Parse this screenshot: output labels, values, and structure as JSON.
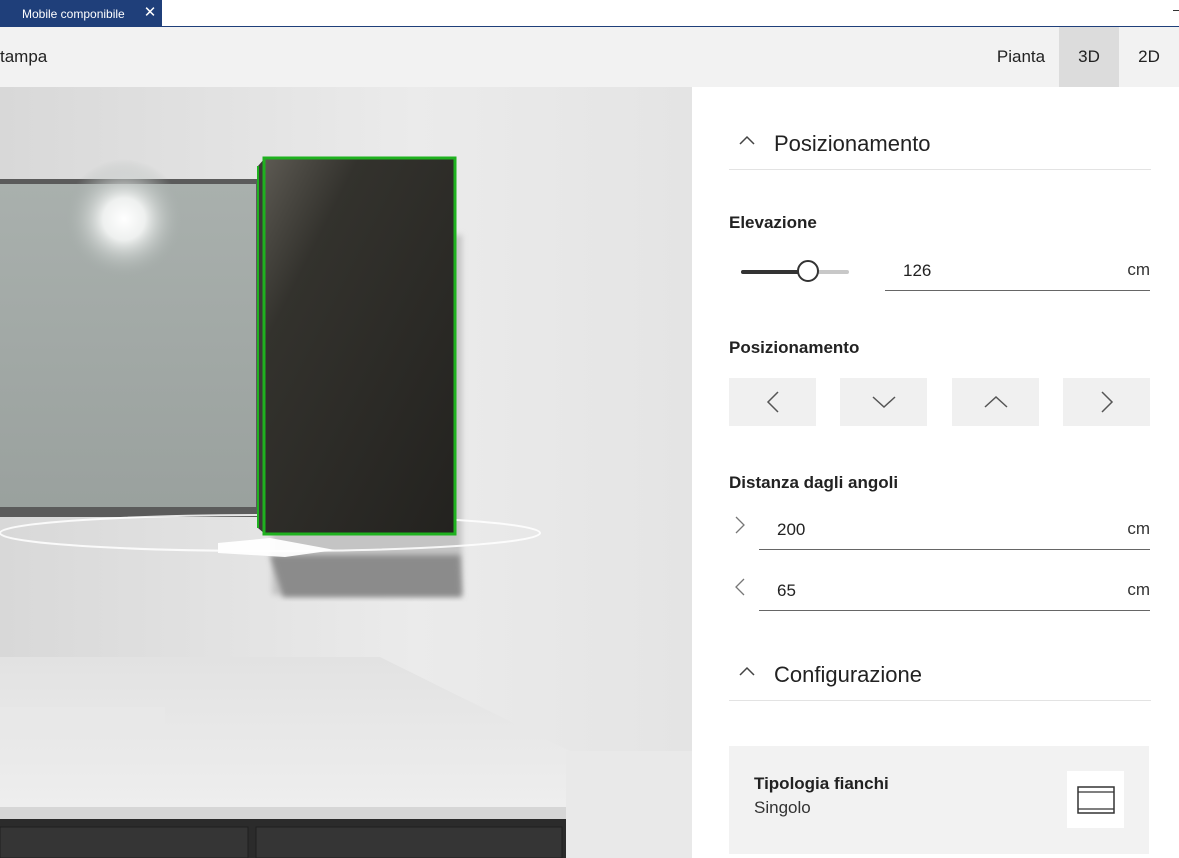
{
  "tab": {
    "title": "Mobile componibile",
    "close_glyph": "✕"
  },
  "toolbar": {
    "left_label": "tampa",
    "views": [
      {
        "label": "Pianta",
        "active": false
      },
      {
        "label": "3D",
        "active": true
      },
      {
        "label": "2D",
        "active": false
      }
    ]
  },
  "panel": {
    "positioning_section": {
      "title": "Posizionamento",
      "icon": "chevron-up-icon"
    },
    "elevation": {
      "label": "Elevazione",
      "value": "126",
      "unit": "cm",
      "slider_fraction": 0.62
    },
    "position": {
      "label": "Posizionamento",
      "buttons": [
        {
          "name": "move-left-button",
          "icon": "chevron-left-icon"
        },
        {
          "name": "move-down-button",
          "icon": "chevron-down-icon"
        },
        {
          "name": "move-up-button",
          "icon": "chevron-up-icon"
        },
        {
          "name": "move-right-button",
          "icon": "chevron-right-icon"
        }
      ]
    },
    "corner_distance": {
      "label": "Distanza dagli angoli",
      "right": {
        "icon": "chevron-right-icon",
        "value": "200",
        "unit": "cm"
      },
      "left": {
        "icon": "chevron-left-icon",
        "value": "65",
        "unit": "cm"
      }
    },
    "configuration_section": {
      "title": "Configurazione",
      "icon": "chevron-up-icon"
    },
    "side_type": {
      "title": "Tipologia fianchi",
      "value": "Singolo",
      "icon": "single-side-thumbnail-icon"
    }
  },
  "colors": {
    "tab_bg": "#1f3f7a",
    "selection": "#1fb11f",
    "cabinet": "#2c2b27",
    "active_view": "#dcdcdc"
  }
}
